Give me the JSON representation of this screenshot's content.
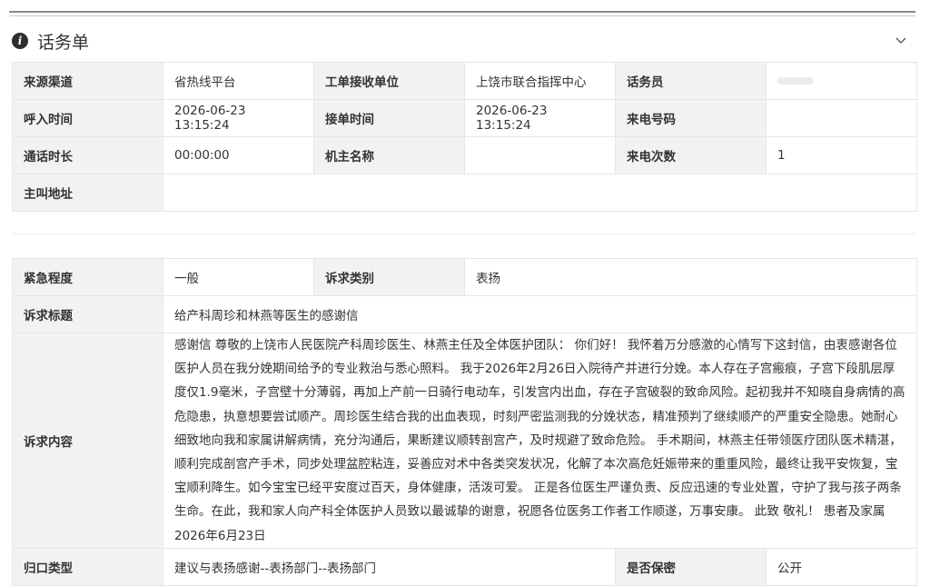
{
  "panel": {
    "title": "话务单",
    "info_icon": "info-icon",
    "collapse_icon": "chevron-down-icon"
  },
  "call": {
    "source_label": "来源渠道",
    "source_value": "省热线平台",
    "unit_label": "工单接收单位",
    "unit_value": "上饶市联合指挥中心",
    "operator_label": "话务员",
    "operator_value": "",
    "call_in_label": "呼入时间",
    "call_in_value": "2026-06-23 13:15:24",
    "answer_label": "接单时间",
    "answer_value": "2026-06-23 13:15:24",
    "phone_label": "来电号码",
    "phone_value": "",
    "duration_label": "通话时长",
    "duration_value": "00:00:00",
    "owner_label": "机主名称",
    "owner_value": "",
    "count_label": "来电次数",
    "count_value": "1",
    "address_label": "主叫地址",
    "address_value": ""
  },
  "request": {
    "urgency_label": "紧急程度",
    "urgency_value": "一般",
    "type_label": "诉求类别",
    "type_value": "表扬",
    "title_label": "诉求标题",
    "title_value": "给产科周珍和林燕等医生的感谢信",
    "content_label": "诉求内容",
    "content_value": "感谢信 尊敬的上饶市人民医院产科周珍医生、林燕主任及全体医护团队： 你们好！ 我怀着万分感激的心情写下这封信，由衷感谢各位医护人员在我分娩期间给予的专业救治与悉心照料。 我于2026年2月26日入院待产并进行分娩。本人存在子宫瘢痕，子宫下段肌层厚度仅1.9毫米，子宫壁十分薄弱，再加上产前一日骑行电动车，引发宫内出血，存在子宫破裂的致命风险。起初我并不知晓自身病情的高危隐患，执意想要尝试顺产。周珍医生结合我的出血表现，时刻严密监测我的分娩状态，精准预判了继续顺产的严重安全隐患。她耐心细致地向我和家属讲解病情，充分沟通后，果断建议顺转剖宫产，及时规避了致命危险。 手术期间，林燕主任带领医疗团队医术精湛，顺利完成剖宫产手术，同步处理盆腔粘连，妥善应对术中各类突发状况，化解了本次高危妊娠带来的重重风险，最终让我平安恢复，宝宝顺利降生。如今宝宝已经平安度过百天，身体健康，活泼可爱。 正是各位医生严谨负责、反应迅速的专业处置，守护了我与孩子两条生命。在此，我和家人向产科全体医护人员致以最诚挚的谢意，祝愿各位医务工作者工作顺遂，万事安康。 此致 敬礼！ 患者及家属 2026年6月23日",
    "category_label": "归口类型",
    "category_value": "建议与表扬感谢--表扬部门--表扬部门",
    "secret_label": "是否保密",
    "secret_value": "公开"
  }
}
